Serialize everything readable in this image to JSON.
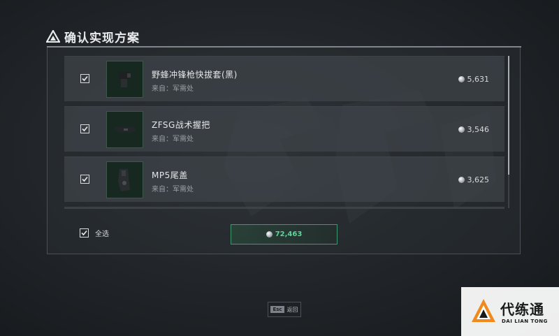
{
  "dialog": {
    "title": "确认实现方案"
  },
  "items": [
    {
      "name": "野蜂冲锋枪快拔套(黑)",
      "source": "来自：军需处",
      "price": "5,631",
      "checked": true,
      "thumb_icon": "holster-icon"
    },
    {
      "name": "ZFSG战术握把",
      "source": "来自：军需处",
      "price": "3,546",
      "checked": true,
      "thumb_icon": "grip-icon"
    },
    {
      "name": "MP5尾盖",
      "source": "来自：军需处",
      "price": "3,625",
      "checked": true,
      "thumb_icon": "stock-cap-icon"
    }
  ],
  "footer": {
    "select_all_label": "全选",
    "select_all_checked": true,
    "total": "72,463"
  },
  "back": {
    "key": "Esc",
    "label": "返回"
  },
  "watermark": {
    "cn": "代练通",
    "en": "DAI LIAN TONG"
  },
  "colors": {
    "accent_green": "#5fd39a",
    "panel_bg": "#3e444a",
    "watermark_orange": "#f08a1c"
  }
}
